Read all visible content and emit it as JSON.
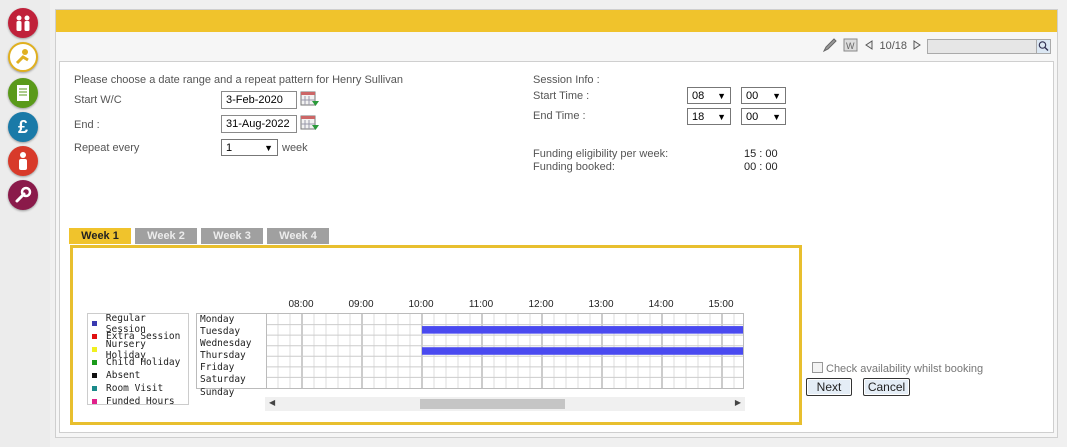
{
  "left_rail": {
    "icons": [
      {
        "name": "family-icon",
        "color": "#c0213a"
      },
      {
        "name": "child-play-icon",
        "color": "#e0b020"
      },
      {
        "name": "register-icon",
        "color": "#5a9a1a"
      },
      {
        "name": "finance-pound-icon",
        "glyph": "£",
        "color": "#1a7aa8"
      },
      {
        "name": "staff-icon",
        "color": "#d83a2a"
      },
      {
        "name": "settings-wrench-icon",
        "color": "#8a1a4a"
      }
    ]
  },
  "toolbar": {
    "nav_count": "10/18",
    "search_value": ""
  },
  "form": {
    "intro": "Please choose a date range and a repeat pattern for Henry Sullivan",
    "start_label": "Start W/C",
    "start_value": "3-Feb-2020",
    "end_label": "End :",
    "end_value": "31-Aug-2022",
    "repeat_label": "Repeat every",
    "repeat_value": "1",
    "repeat_unit": "week"
  },
  "session": {
    "title": "Session Info :",
    "start_time_label": "Start Time :",
    "start_hour": "08",
    "start_min": "00",
    "end_time_label": "End Time :",
    "end_hour": "18",
    "end_min": "00",
    "funding_eligibility_label": "Funding eligibility per week:",
    "funding_eligibility_value": "15 : 00",
    "funding_booked_label": "Funding booked:",
    "funding_booked_value": "00 : 00"
  },
  "tabs": [
    {
      "label": "Week 1",
      "active": true
    },
    {
      "label": "Week 2",
      "active": false
    },
    {
      "label": "Week 3",
      "active": false
    },
    {
      "label": "Week 4",
      "active": false
    }
  ],
  "legend": [
    {
      "label": "Regular Session",
      "color": "#3a3ab0"
    },
    {
      "label": "Extra Session",
      "color": "#e01010"
    },
    {
      "label": "Nursery Holiday",
      "color": "#f0f020"
    },
    {
      "label": "Child Holiday",
      "color": "#1a9a1a"
    },
    {
      "label": "Absent",
      "color": "#111111"
    },
    {
      "label": "Room Visit",
      "color": "#1a8a8a"
    },
    {
      "label": "Funded Hours",
      "color": "#e0208a"
    }
  ],
  "schedule": {
    "days": [
      "Monday",
      "Tuesday",
      "Wednesday",
      "Thursday",
      "Friday",
      "Saturday",
      "Sunday"
    ],
    "times": [
      "08:00",
      "09:00",
      "10:00",
      "11:00",
      "12:00",
      "13:00",
      "14:00",
      "15:00"
    ],
    "bar_color": "#4a4af0",
    "bookings": [
      {
        "day": "Tuesday",
        "start": "10:00",
        "end": "18:00"
      },
      {
        "day": "Thursday",
        "start": "10:00",
        "end": "18:00"
      }
    ]
  },
  "actions": {
    "check_availability_label": "Check availability whilst booking",
    "next_label": "Next",
    "cancel_label": "Cancel"
  }
}
